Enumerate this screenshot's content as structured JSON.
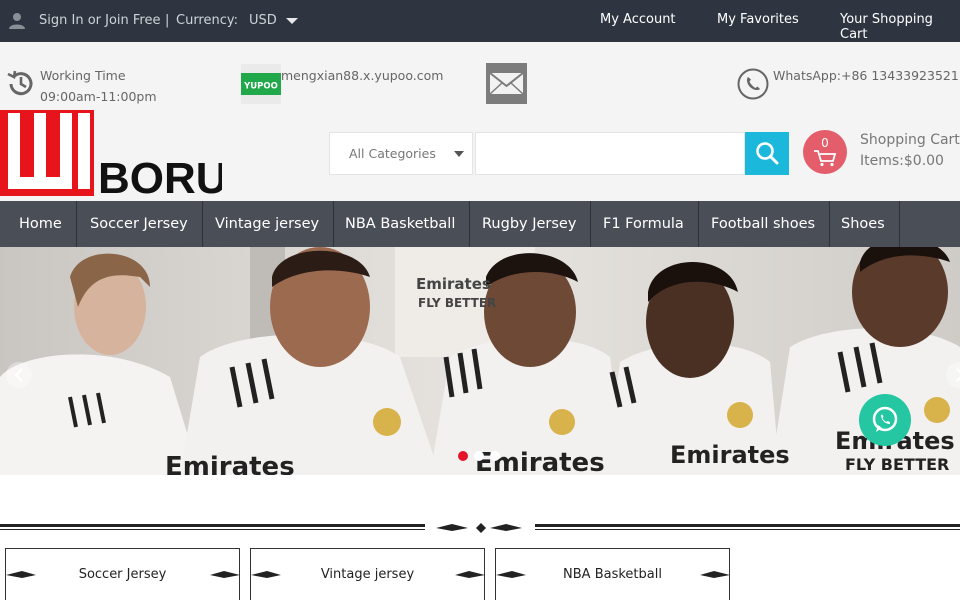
{
  "topbar": {
    "signin": "Sign In or Join Free",
    "separator": "|",
    "currency_label": "Currency:",
    "currency_value": "USD",
    "links": [
      "My Account",
      "My Favorites",
      "Your Shopping Cart"
    ]
  },
  "info": {
    "working_time_title": "Working Time",
    "working_time_hours": "09:00am-11:00pm",
    "yupoo_logo_text": "YUPOO",
    "yupoo_link": "mengxian88.x.yupoo.com",
    "whatsapp": "WhatsApp:+86 13433923521"
  },
  "logo": {
    "text_left": "WU",
    "text_right": "BORU"
  },
  "search": {
    "category": "All Categories",
    "placeholder": ""
  },
  "cart": {
    "count": "0",
    "title": "Shopping Cart",
    "items": "Items:$0.00"
  },
  "nav": [
    "Home",
    "Soccer Jersey",
    "Vintage jersey",
    "NBA Basketball",
    "Rugby Jersey",
    "F1 Formula",
    "Football shoes",
    "Shoes"
  ],
  "banner": {
    "shirt_text_1": "Emirates",
    "shirt_text_2": "FLY BETTER",
    "brand_text": "adidas",
    "slides": 3,
    "active_slide": 1
  },
  "categories": [
    "Soccer Jersey",
    "Vintage jersey",
    "NBA Basketball"
  ],
  "colors": {
    "topbar": "#2f3540",
    "nav": "#4a4f57",
    "search_button": "#1cb8dc",
    "cart_badge": "#e35d6a",
    "logo_red": "#e8141c",
    "whatsapp_float": "#25c6a2",
    "slider_active": "#e4142b"
  }
}
